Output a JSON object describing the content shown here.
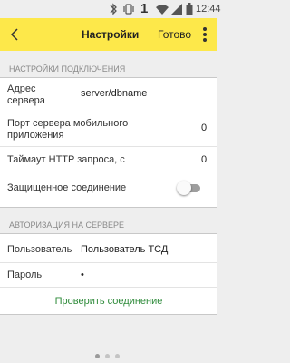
{
  "status_bar": {
    "indicator": "1",
    "time": "12:44",
    "icons": [
      "bluetooth-icon",
      "vibrate-icon",
      "wifi-icon",
      "signal-icon",
      "battery-icon"
    ]
  },
  "app_bar": {
    "title": "Настройки",
    "done_label": "Готово",
    "back_icon": "arrow-back-icon",
    "menu_icon": "more-vert-icon",
    "background_color": "#fde84a"
  },
  "connection_settings": {
    "section_title": "НАСТРОЙКИ ПОДКЛЮЧЕНИЯ",
    "server_address": {
      "label_line1": "Адрес",
      "label_line2": "сервера",
      "value": "server/dbname"
    },
    "mobile_port": {
      "label_line1": "Порт сервера мобильного",
      "label_line2": "приложения",
      "value": "0"
    },
    "http_timeout": {
      "label": "Таймаут HTTP запроса, с",
      "value": "0"
    },
    "secure_connection": {
      "label": "Защищенное соединение",
      "enabled": false
    }
  },
  "server_authorization": {
    "section_title": "АВТОРИЗАЦИЯ НА СЕРВЕРЕ",
    "user": {
      "label": "Пользователь",
      "value": "Пользователь ТСД"
    },
    "password": {
      "label": "Пароль",
      "value": "•"
    },
    "check_connection_label": "Проверить соединение",
    "check_connection_color": "#2e8b3a"
  },
  "pager": {
    "pages": 3,
    "current": 1
  }
}
